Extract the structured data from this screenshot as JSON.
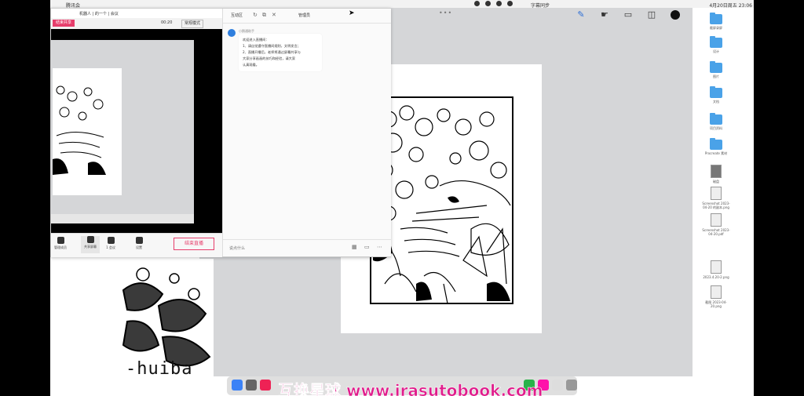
{
  "menubar": {
    "app_name": "腾讯会",
    "speaker": "字幕同步",
    "clock": "4月20日周五 23:06"
  },
  "meeting": {
    "window_title": "机器人 | 的一个 | 会议",
    "end_share_label": "结束共享",
    "timer": "00:20",
    "mode_select": "常规模式",
    "toolbar": [
      {
        "label": "管理成员",
        "icon": "participants-icon"
      },
      {
        "label": "共享屏幕",
        "icon": "screen-share-icon"
      },
      {
        "label": "1 会议",
        "icon": "meeting-icon"
      },
      {
        "label": "设置",
        "icon": "settings-icon"
      }
    ],
    "end_live_label": "结束直播"
  },
  "chat": {
    "tab_interact": "互动区",
    "tab_manage": "管理员",
    "sender": "小鹅通助手",
    "message_lines": [
      "欢迎进入直播间：",
      "1、请自觉遵守直播间规则，文明发言；",
      "2、直播开播后，老师将通过屏幕共享与",
      "大家分享画画的技巧和经验，请大家",
      "认真观看。"
    ],
    "input_placeholder": "说点什么"
  },
  "drawapp": {
    "dots": "•••"
  },
  "desktop_icons": [
    {
      "type": "folder",
      "label": "截屏录屏"
    },
    {
      "type": "folder",
      "label": "设计"
    },
    {
      "type": "folder",
      "label": "图片"
    },
    {
      "type": "folder",
      "label": "文档"
    },
    {
      "type": "folder",
      "label": "项目资料"
    },
    {
      "type": "folder",
      "label": "Procreate 素材"
    },
    {
      "type": "file",
      "label": "磁盘"
    },
    {
      "type": "file",
      "label": "Screenshot 2023-04-20 的副本.png"
    },
    {
      "type": "file",
      "label": "Screenshot 2023-04-20.pdf"
    },
    {
      "type": "file",
      "label": "2023.4.20-2.png"
    },
    {
      "type": "file",
      "label": "截图 2023-04-20.png"
    }
  ],
  "sticker_text": "-huiba",
  "watermark": "互换星球 www.irasutobook.com"
}
